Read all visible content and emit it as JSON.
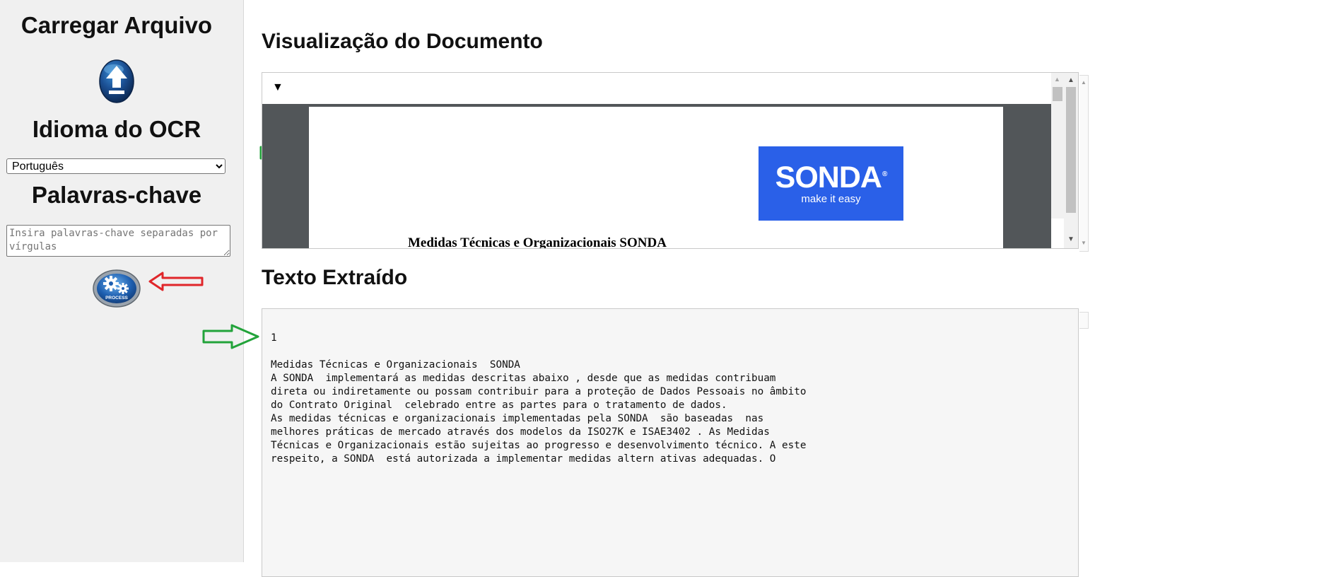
{
  "sidebar": {
    "upload_heading": "Carregar Arquivo",
    "ocr_heading": "Idioma do OCR",
    "ocr_language_selected": "Português",
    "keywords_heading": "Palavras-chave",
    "keywords_placeholder": "Insira palavras-chave separadas por vírgulas",
    "keywords_value": "",
    "process_button_label": "PROCESS",
    "upload_icon": "upload-arrow-icon",
    "process_icon": "gears-icon"
  },
  "main": {
    "preview_heading": "Visualização do Documento",
    "preview_toggle": "▼",
    "pdf_logo_word": "SONDA",
    "pdf_logo_reg": "®",
    "pdf_logo_tagline": "make it easy",
    "pdf_doc_title": "Medidas Técnicas e Organizacionais SONDA",
    "extracted_heading": "Texto Extraído",
    "extracted_text": "1\n\nMedidas Técnicas e Organizacionais  SONDA\nA SONDA  implementará as medidas descritas abaixo , desde que as medidas contribuam\ndireta ou indiretamente ou possam contribuir para a proteção de Dados Pessoais no âmbito\ndo Contrato Original  celebrado entre as partes para o tratamento de dados.\nAs medidas técnicas e organizacionais implementadas pela SONDA  são baseadas  nas\nmelhores práticas de mercado através dos modelos da ISO27K e ISAE3402 . As Medidas\nTécnicas e Organizacionais estão sujeitas ao progresso e desenvolvimento técnico. A este\nrespeito, a SONDA  está autorizada a implementar medidas altern ativas adequadas. O"
  },
  "colors": {
    "sidebar_bg": "#f0f0f0",
    "logo_blue": "#2a60e8",
    "pdf_viewer_bg": "#525659",
    "annotation_green": "#22a33a",
    "annotation_red": "#e0262a"
  }
}
